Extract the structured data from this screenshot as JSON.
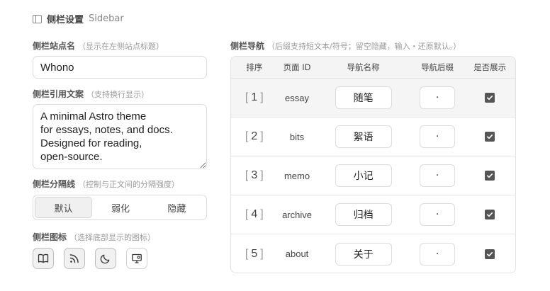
{
  "header": {
    "title": "侧栏设置",
    "subtitle": "Sidebar",
    "icon": "sidebar-icon"
  },
  "site_name": {
    "label": "侧栏站点名",
    "hint": "（显示在左侧站点标题）",
    "value": "Whono"
  },
  "quote": {
    "label": "侧栏引用文案",
    "hint": "（支持换行显示）",
    "value": "A minimal Astro theme\nfor essays, notes, and docs.\nDesigned for reading,\nopen-source."
  },
  "divider": {
    "label": "侧栏分隔线",
    "hint": "（控制与正文间的分隔强度）",
    "options": [
      "默认",
      "弱化",
      "隐藏"
    ],
    "selected": "默认"
  },
  "icons": {
    "label": "侧栏图标",
    "hint": "（选择底部显示的图标）",
    "items": [
      {
        "name": "book-open-icon",
        "selected": true
      },
      {
        "name": "rss-icon",
        "selected": true
      },
      {
        "name": "moon-icon",
        "selected": true
      },
      {
        "name": "monitor-settings-icon",
        "selected": false
      }
    ]
  },
  "nav": {
    "label": "侧栏导航",
    "hint": "（后缀支持短文本/符号；留空隐藏，输入・还原默认。）",
    "columns": [
      "排序",
      "页面 ID",
      "导航名称",
      "导航后缀",
      "是否展示"
    ],
    "rows": [
      {
        "order": "1",
        "id": "essay",
        "name": "随笔",
        "suffix": "·",
        "show": true
      },
      {
        "order": "2",
        "id": "bits",
        "name": "絮语",
        "suffix": "·",
        "show": true
      },
      {
        "order": "3",
        "id": "memo",
        "name": "小记",
        "suffix": "·",
        "show": true
      },
      {
        "order": "4",
        "id": "archive",
        "name": "归档",
        "suffix": "·",
        "show": true
      },
      {
        "order": "5",
        "id": "about",
        "name": "关于",
        "suffix": "·",
        "show": true
      }
    ]
  },
  "colors": {
    "accent": "#555555",
    "border": "#dcdcdc",
    "header_bg": "#f4f4f4"
  }
}
